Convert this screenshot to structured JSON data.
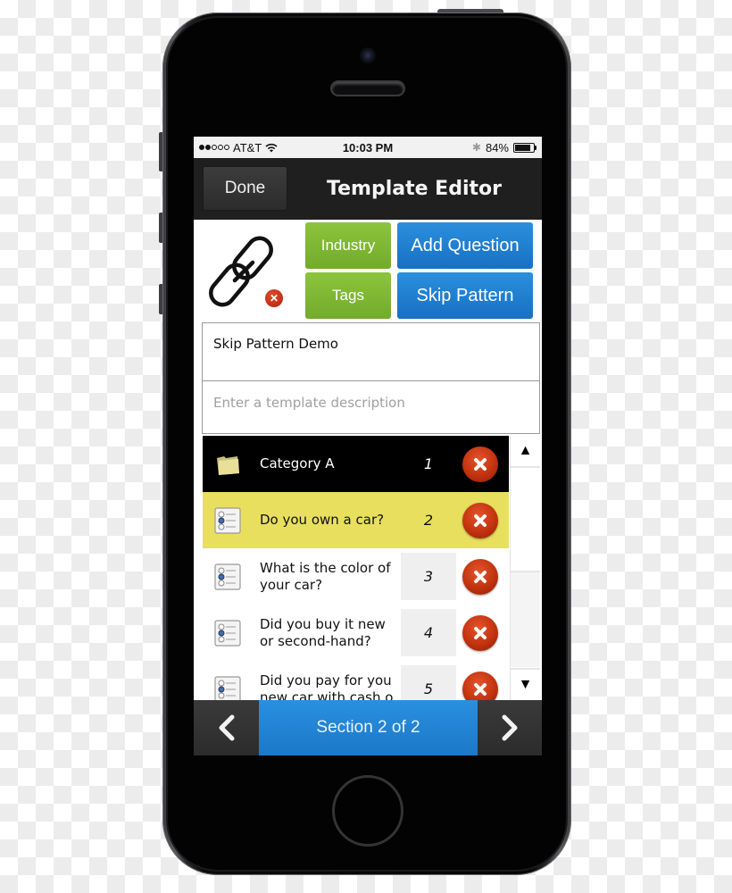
{
  "status_bar": {
    "signal_bars_filled": 2,
    "signal_bars_total": 5,
    "carrier": "AT&T",
    "wifi_icon": "wifi-icon",
    "time": "10:03 PM",
    "bluetooth_icon": "bluetooth-icon",
    "battery_percent_label": "84%",
    "battery_level": 0.84
  },
  "nav_bar": {
    "done_label": "Done",
    "title": "Template Editor"
  },
  "toolbar": {
    "link_icon": "link-icon",
    "remove_link_icon": "close-icon",
    "industry_label": "Industry",
    "tags_label": "Tags",
    "add_question_label": "Add Question",
    "skip_pattern_label": "Skip Pattern"
  },
  "template": {
    "name_value": "Skip Pattern Demo",
    "description_value": "",
    "description_placeholder": "Enter a template description"
  },
  "list": {
    "items": [
      {
        "type": "category",
        "icon": "folder-icon",
        "text": "Category A",
        "number": "1",
        "style": "category"
      },
      {
        "type": "question",
        "icon": "radio-list-icon",
        "text": "Do you own a car?",
        "number": "2",
        "style": "selected"
      },
      {
        "type": "question",
        "icon": "radio-list-icon",
        "text": "What is the color of\nyour car?",
        "number": "3",
        "style": "plain"
      },
      {
        "type": "question",
        "icon": "radio-list-icon",
        "text": "Did you buy it new\nor second-hand?",
        "number": "4",
        "style": "plain"
      },
      {
        "type": "question",
        "icon": "radio-list-icon",
        "text": "Did you pay for you\nnew car with cash o",
        "number": "5",
        "style": "plain"
      }
    ],
    "delete_icon": "delete-icon",
    "scroll_up_glyph": "▲",
    "scroll_down_glyph": "▼"
  },
  "footer": {
    "prev_icon": "chevron-left-icon",
    "section_label": "Section 2 of 2",
    "next_icon": "chevron-right-icon"
  },
  "colors": {
    "nav_bg": "#1f1f1f",
    "green_button": "#7fb832",
    "blue_button": "#1f80d0",
    "category_row": "#000000",
    "selected_row": "#e8df5e",
    "delete_red": "#c2330f"
  }
}
